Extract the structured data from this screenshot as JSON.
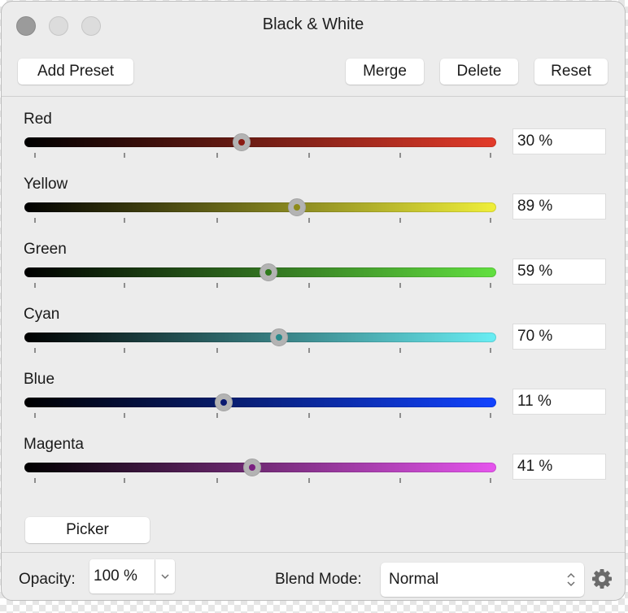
{
  "window": {
    "title": "Black & White"
  },
  "toolbar": {
    "add_preset": "Add Preset",
    "merge": "Merge",
    "delete": "Delete",
    "reset": "Reset"
  },
  "sliders": [
    {
      "label": "Red",
      "value": 30,
      "value_text": "30 %",
      "track_end_color": "#e33b2a",
      "dot_color": "#8a1a12"
    },
    {
      "label": "Yellow",
      "value": 89,
      "value_text": "89 %",
      "track_end_color": "#f0ef3a",
      "dot_color": "#8d8a1a"
    },
    {
      "label": "Green",
      "value": 59,
      "value_text": "59 %",
      "track_end_color": "#62e040",
      "dot_color": "#2f7a1c"
    },
    {
      "label": "Cyan",
      "value": 70,
      "value_text": "70 %",
      "track_end_color": "#69eef4",
      "dot_color": "#2a8a8c"
    },
    {
      "label": "Blue",
      "value": 11,
      "value_text": "11 %",
      "track_end_color": "#1243ff",
      "dot_color": "#0a1970"
    },
    {
      "label": "Magenta",
      "value": 41,
      "value_text": "41 %",
      "track_end_color": "#e655ee",
      "dot_color": "#7a1f80"
    }
  ],
  "picker": {
    "label": "Picker"
  },
  "footer": {
    "opacity_label": "Opacity:",
    "opacity_value": "100 %",
    "blend_label": "Blend Mode:",
    "blend_value": "Normal"
  },
  "icons": {
    "gear": "gear-icon",
    "chevron": "chevron-down-icon",
    "updown": "up-down-chevron-icon"
  }
}
